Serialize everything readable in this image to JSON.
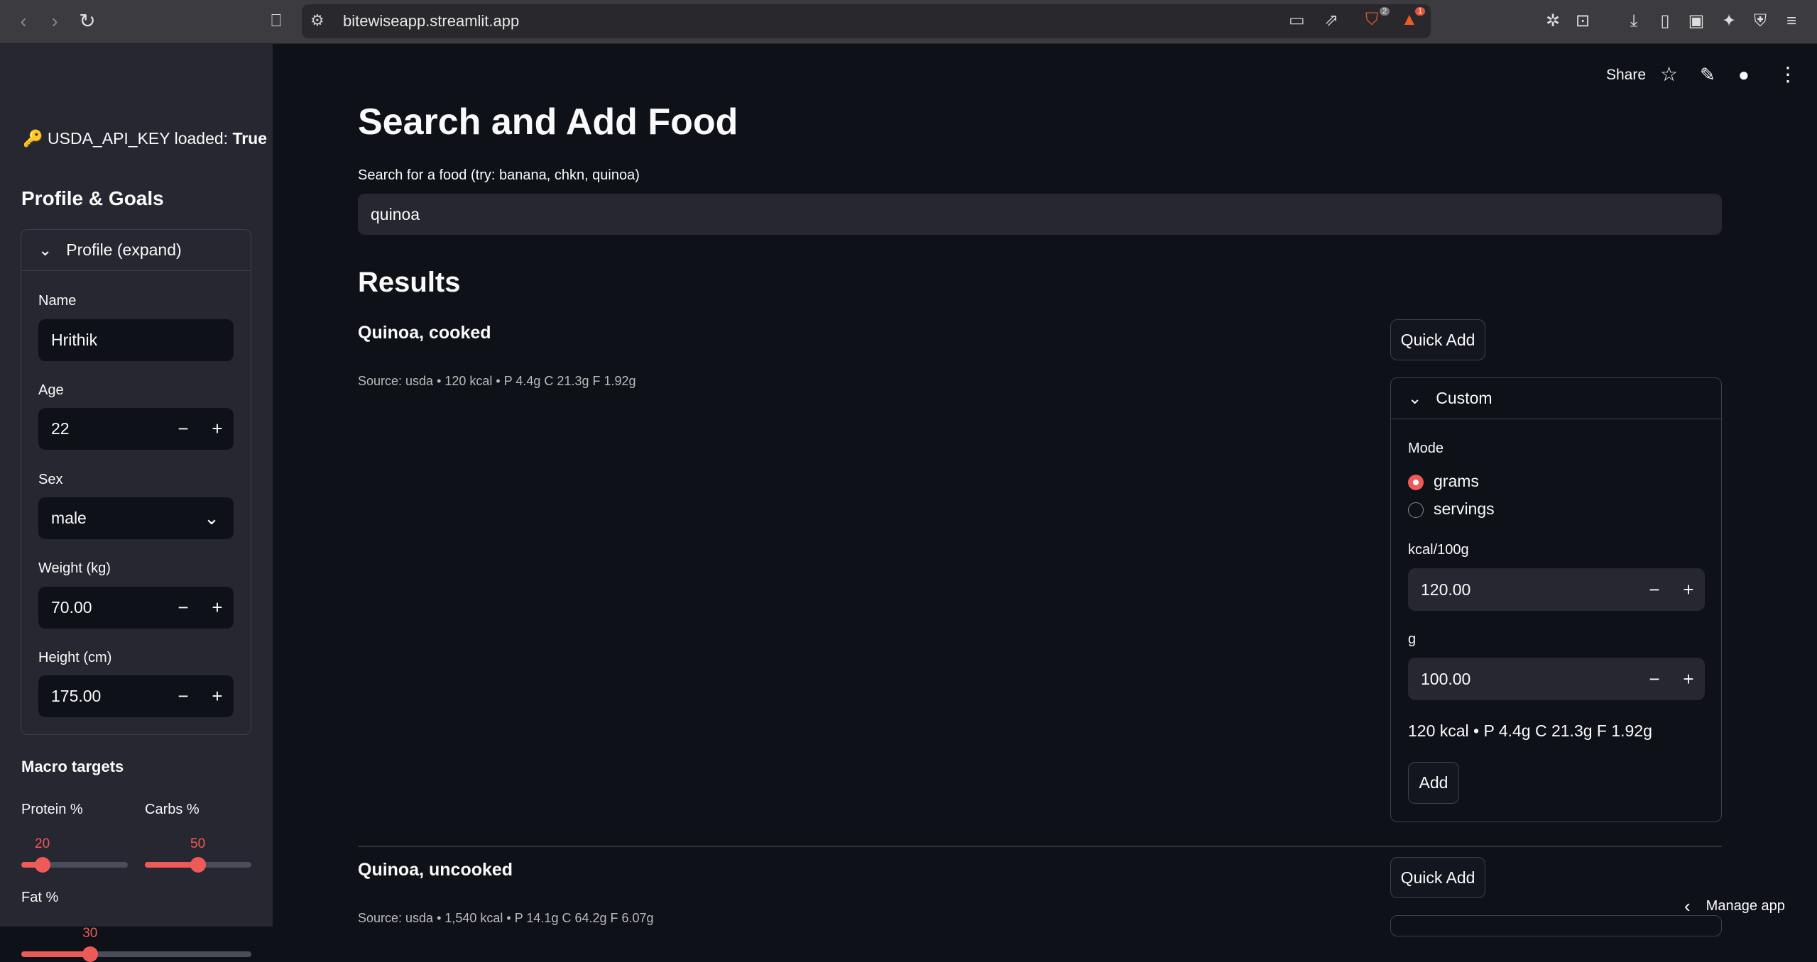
{
  "browser": {
    "url": "bitewiseapp.streamlit.app",
    "brave_badge": "2",
    "rewards_badge": "1"
  },
  "header": {
    "share_label": "Share",
    "manage_app_label": "Manage app"
  },
  "sidebar": {
    "api_key_status_label": "USDA_API_KEY loaded: ",
    "api_key_status_value": "True",
    "api_key_icon": "🔑",
    "section_title": "Profile & Goals",
    "profile_expander": {
      "label": "Profile (expand)",
      "name": {
        "label": "Name",
        "value": "Hrithik"
      },
      "age": {
        "label": "Age",
        "value": "22"
      },
      "sex": {
        "label": "Sex",
        "value": "male"
      },
      "weight": {
        "label": "Weight (kg)",
        "value": "70.00"
      },
      "height": {
        "label": "Height (cm)",
        "value": "175.00"
      }
    },
    "macro_title": "Macro targets",
    "protein": {
      "label": "Protein %",
      "value": "20",
      "fraction": 0.2
    },
    "carbs": {
      "label": "Carbs %",
      "value": "50",
      "fraction": 0.5
    },
    "fat": {
      "label": "Fat %",
      "value": "30",
      "fraction": 0.3
    }
  },
  "main": {
    "title": "Search and Add Food",
    "search": {
      "label": "Search for a food (try: banana, chkn, quinoa)",
      "value": "quinoa"
    },
    "results_title": "Results",
    "results": [
      {
        "name": "Quinoa, cooked",
        "source": "Source: usda • 120 kcal • P 4.4g C 21.3g F 1.92g",
        "quick_add": "Quick Add"
      },
      {
        "name": "Quinoa, uncooked",
        "source": "Source: usda • 1,540 kcal • P 14.1g C 64.2g F 6.07g",
        "quick_add": "Quick Add"
      }
    ],
    "custom": {
      "label": "Custom",
      "mode_label": "Mode",
      "options": [
        "grams",
        "servings"
      ],
      "selected": "grams",
      "kcal": {
        "label": "kcal/100g",
        "value": "120.00"
      },
      "grams": {
        "label": "g",
        "value": "100.00"
      },
      "summary": "120 kcal • P 4.4g C 21.3g F 1.92g",
      "add_label": "Add"
    }
  },
  "colors": {
    "accent": "#ee5a58",
    "background": "#0e1117",
    "sidebar": "#262730"
  }
}
